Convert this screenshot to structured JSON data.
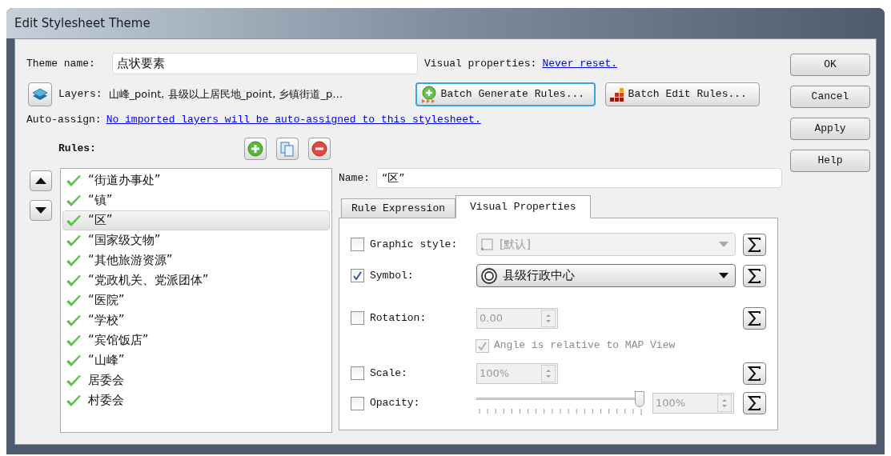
{
  "window": {
    "title": "Edit Stylesheet Theme"
  },
  "theme_name": {
    "label": "Theme name:",
    "value": "点状要素"
  },
  "visual_properties": {
    "label": "Visual properties:",
    "link": "Never reset."
  },
  "layers": {
    "label": "Layers:",
    "value": "山峰_point, 县级以上居民地_point, 乡镇街道_p…"
  },
  "batch_buttons": [
    {
      "kind": "generate",
      "label": "Batch Generate Rules...",
      "focused": true
    },
    {
      "kind": "edit",
      "label": "Batch Edit Rules...",
      "focused": false
    }
  ],
  "auto_assign": {
    "label": "Auto-assign:",
    "link": "No imported layers will be auto-assigned to this stylesheet."
  },
  "rules": {
    "label": "Rules:",
    "items": [
      {
        "label": "“街道办事处”",
        "enabled": true,
        "selected": false
      },
      {
        "label": "“镇”",
        "enabled": true,
        "selected": false
      },
      {
        "label": "“区”",
        "enabled": true,
        "selected": true
      },
      {
        "label": "“国家级文物”",
        "enabled": true,
        "selected": false
      },
      {
        "label": "“其他旅游资源”",
        "enabled": true,
        "selected": false
      },
      {
        "label": "“党政机关、党派团体”",
        "enabled": true,
        "selected": false
      },
      {
        "label": "“医院”",
        "enabled": true,
        "selected": false
      },
      {
        "label": "“学校”",
        "enabled": true,
        "selected": false
      },
      {
        "label": "“宾馆饭店”",
        "enabled": true,
        "selected": false
      },
      {
        "label": "“山峰”",
        "enabled": true,
        "selected": false
      },
      {
        "label": "居委会",
        "enabled": true,
        "selected": false
      },
      {
        "label": "村委会",
        "enabled": true,
        "selected": false
      }
    ]
  },
  "rule_editor": {
    "name": {
      "label": "Name:",
      "value": "“区”"
    },
    "tabs": [
      {
        "label": "Rule Expression",
        "selected": false
      },
      {
        "label": "Visual Properties",
        "selected": true
      }
    ],
    "properties": [
      {
        "kind": "combo",
        "label": "Graphic style:",
        "checked": false,
        "value": "[默认]",
        "disabled": true
      },
      {
        "kind": "combo",
        "label": "Symbol:",
        "checked": true,
        "value": "县级行政中心",
        "disabled": false
      },
      {
        "kind": "spin",
        "label": "Rotation:",
        "checked": false,
        "value": "0.00"
      },
      {
        "kind": "option",
        "label": "Angle is relative to MAP View",
        "checked": true,
        "disabled": true
      },
      {
        "kind": "spin",
        "label": "Scale:",
        "checked": false,
        "value": "100%"
      },
      {
        "kind": "slider",
        "label": "Opacity:",
        "checked": false,
        "level": 1,
        "value": "100%"
      }
    ]
  },
  "dialog_buttons": [
    "OK",
    "Cancel",
    "Apply",
    "Help"
  ]
}
